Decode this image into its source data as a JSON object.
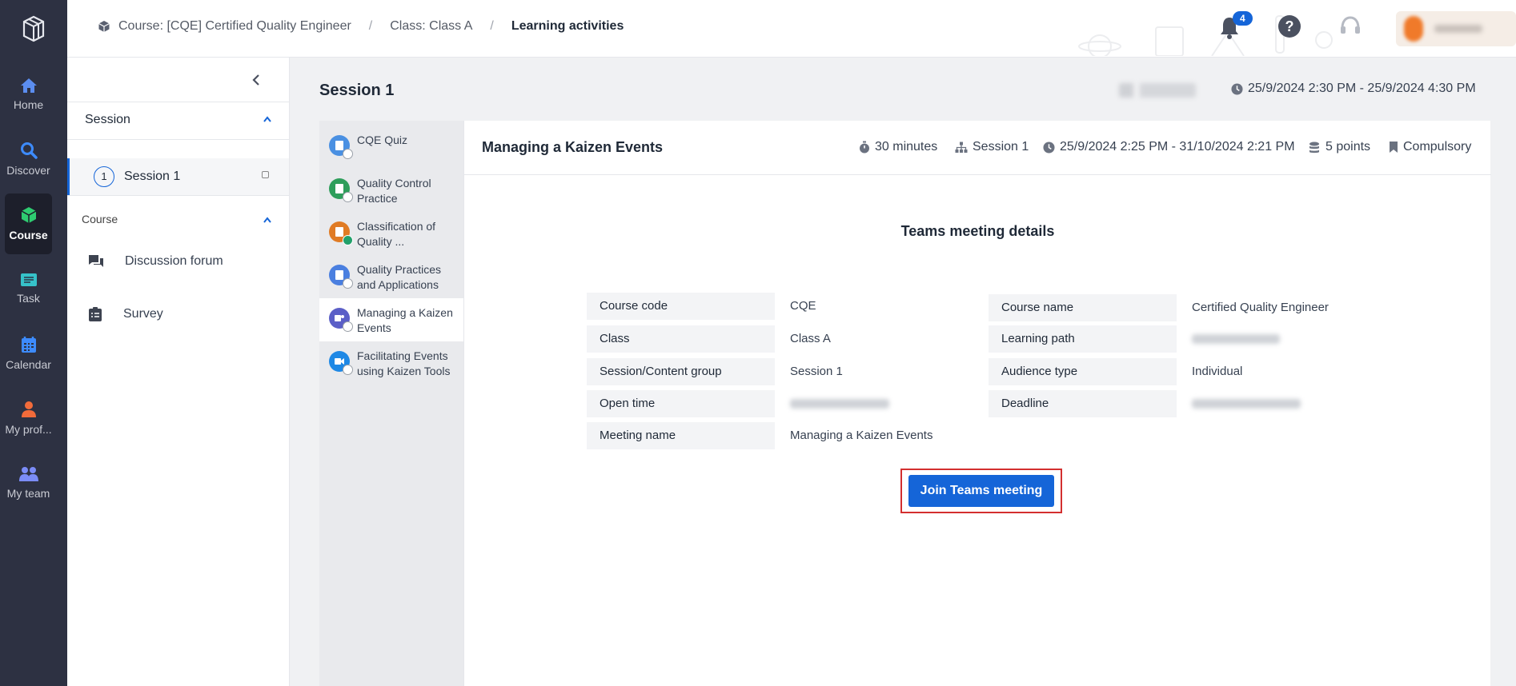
{
  "nav": {
    "items": [
      {
        "label": "Home",
        "icon": "home-icon",
        "color": "#5b8def"
      },
      {
        "label": "Discover",
        "icon": "search-icon",
        "color": "#3d8bfd"
      },
      {
        "label": "Course",
        "icon": "cube-icon",
        "color": "#2ecc71"
      },
      {
        "label": "Task",
        "icon": "task-icon",
        "color": "#36c2c9"
      },
      {
        "label": "Calendar",
        "icon": "calendar-icon",
        "color": "#3d8bfd"
      },
      {
        "label": "My prof...",
        "icon": "user-icon",
        "color": "#f26b3a"
      },
      {
        "label": "My team",
        "icon": "team-icon",
        "color": "#7b8cf7"
      }
    ]
  },
  "header": {
    "breadcrumb": [
      "Course: [CQE] Certified Quality Engineer",
      "Class: Class A",
      "Learning activities"
    ],
    "notification_count": "4"
  },
  "sidebar": {
    "session_heading": "Session",
    "session_item_number": "1",
    "session_item_label": "Session 1",
    "course_heading": "Course",
    "links": [
      "Discussion forum",
      "Survey"
    ]
  },
  "main": {
    "title": "Session 1",
    "session_time": "25/9/2024 2:30 PM - 25/9/2024 4:30 PM"
  },
  "activities": [
    {
      "label": "CQE Quiz",
      "color": "#4a90e2",
      "status": "pending"
    },
    {
      "label": "Quality Control Practice",
      "color": "#2e9e5b",
      "status": "pending"
    },
    {
      "label": "Classification of Quality ...",
      "color": "#e07b24",
      "status": "done"
    },
    {
      "label": "Quality Practices and Applications",
      "color": "#4a7fe0",
      "status": "pending"
    },
    {
      "label": "Managing a Kaizen Events",
      "color": "#5b5fc7",
      "status": "pending"
    },
    {
      "label": "Facilitating Events using Kaizen Tools",
      "color": "#1e88e5",
      "status": "pending"
    }
  ],
  "panel": {
    "title": "Managing a Kaizen Events",
    "duration": "30 minutes",
    "session": "Session 1",
    "period": "25/9/2024 2:25 PM - 31/10/2024 2:21 PM",
    "points": "5 points",
    "requirement": "Compulsory"
  },
  "teams": {
    "heading": "Teams meeting details",
    "rows_left": [
      {
        "label": "Course code",
        "value": "CQE"
      },
      {
        "label": "Class",
        "value": "Class A"
      },
      {
        "label": "Session/Content group",
        "value": "Session 1"
      },
      {
        "label": "Open time",
        "value": ""
      },
      {
        "label": "Meeting name",
        "value": "Managing a Kaizen Events"
      }
    ],
    "rows_right": [
      {
        "label": "Course name",
        "value": "Certified Quality Engineer"
      },
      {
        "label": "Learning path",
        "value": ""
      },
      {
        "label": "Audience type",
        "value": "Individual"
      },
      {
        "label": "Deadline",
        "value": ""
      }
    ],
    "join_button": "Join Teams meeting",
    "accent_color": "#1565d8",
    "highlight_color": "#d32f2f"
  }
}
